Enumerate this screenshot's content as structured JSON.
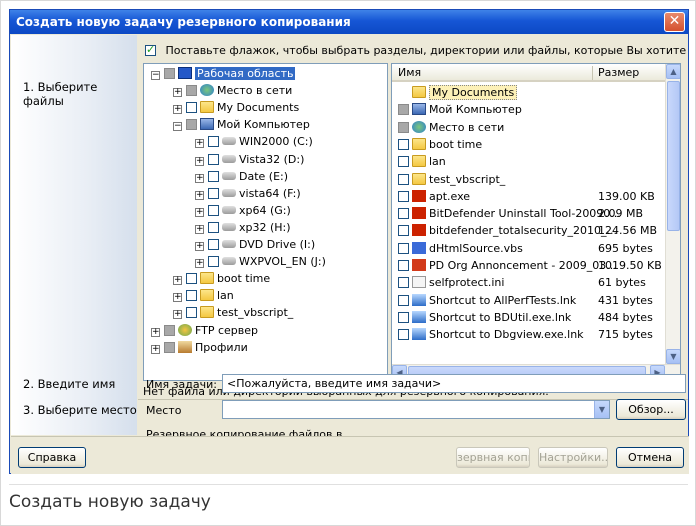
{
  "window": {
    "title": "Создать новую задачу резервного копирования",
    "close_label": "✕"
  },
  "steps": {
    "step1": "1. Выберите файлы",
    "step2": "2. Введите имя",
    "step3": "3. Выберите место"
  },
  "select_all_label": "Поставьте флажок, чтобы выбрать разделы, директории или файлы, которые Вы хотите",
  "tree": [
    {
      "label": "Рабочая область",
      "icon": "workspace-icon",
      "level": 0,
      "expander": "−",
      "state": "gray",
      "selected": true
    },
    {
      "label": "Место в сети",
      "icon": "network-icon",
      "level": 1,
      "expander": "+",
      "state": "gray"
    },
    {
      "label": "My Documents",
      "icon": "folder-icon",
      "level": 1,
      "expander": "+",
      "state": "empty"
    },
    {
      "label": "Мой Компьютер",
      "icon": "computer-icon",
      "level": 1,
      "expander": "−",
      "state": "gray"
    },
    {
      "label": "WIN2000 (C:)",
      "icon": "drive-icon",
      "level": 2,
      "expander": "+",
      "state": "empty"
    },
    {
      "label": "Vista32 (D:)",
      "icon": "drive-icon",
      "level": 2,
      "expander": "+",
      "state": "empty"
    },
    {
      "label": "Date (E:)",
      "icon": "drive-icon",
      "level": 2,
      "expander": "+",
      "state": "empty"
    },
    {
      "label": "vista64 (F:)",
      "icon": "drive-icon",
      "level": 2,
      "expander": "+",
      "state": "empty"
    },
    {
      "label": "xp64 (G:)",
      "icon": "drive-icon",
      "level": 2,
      "expander": "+",
      "state": "empty"
    },
    {
      "label": "xp32 (H:)",
      "icon": "drive-icon",
      "level": 2,
      "expander": "+",
      "state": "empty"
    },
    {
      "label": "DVD Drive (I:)",
      "icon": "dvd-icon",
      "level": 2,
      "expander": "+",
      "state": "empty"
    },
    {
      "label": "WXPVOL_EN (J:)",
      "icon": "dvd-icon",
      "level": 2,
      "expander": "+",
      "state": "empty"
    },
    {
      "label": "boot time",
      "icon": "folder-icon",
      "level": 1,
      "expander": "+",
      "state": "empty"
    },
    {
      "label": "lan",
      "icon": "folder-icon",
      "level": 1,
      "expander": "+",
      "state": "empty"
    },
    {
      "label": "test_vbscript_",
      "icon": "folder-icon",
      "level": 1,
      "expander": "+",
      "state": "empty"
    },
    {
      "label": "FTP сервер",
      "icon": "ftp-icon",
      "level": 0,
      "expander": "+",
      "state": "gray"
    },
    {
      "label": "Профили",
      "icon": "profile-icon",
      "level": 0,
      "expander": "+",
      "state": "gray"
    }
  ],
  "filelist": {
    "col_name": "Имя",
    "col_size": "Размер",
    "rows": [
      {
        "name": "My Documents",
        "size": "",
        "icon": "folder-icon",
        "state": "none"
      },
      {
        "name": "Мой Компьютер",
        "size": "",
        "icon": "computer-icon",
        "state": "gray"
      },
      {
        "name": "Место в сети",
        "size": "",
        "icon": "network-icon",
        "state": "gray"
      },
      {
        "name": "boot time",
        "size": "",
        "icon": "folder-icon",
        "state": "empty"
      },
      {
        "name": "lan",
        "size": "",
        "icon": "folder-icon",
        "state": "empty"
      },
      {
        "name": "test_vbscript_",
        "size": "",
        "icon": "folder-icon",
        "state": "empty"
      },
      {
        "name": "apt.exe",
        "size": "139.00 KB",
        "icon": "exe-icon",
        "state": "empty"
      },
      {
        "name": "BitDefender Uninstall Tool-20090...",
        "size": "2.09 MB",
        "icon": "exe-icon",
        "state": "empty"
      },
      {
        "name": "bitdefender_totalsecurity_2010_...",
        "size": "124.56 MB",
        "icon": "exe-icon",
        "state": "empty"
      },
      {
        "name": "dHtmlSource.vbs",
        "size": "695 bytes",
        "icon": "vbs-icon",
        "state": "empty"
      },
      {
        "name": "PD Org Annoncement - 2009_03...",
        "size": "1019.50 KB",
        "icon": "pdf-icon",
        "state": "empty"
      },
      {
        "name": "selfprotect.ini",
        "size": "61 bytes",
        "icon": "ini-icon",
        "state": "empty"
      },
      {
        "name": "Shortcut to AllPerfTests.lnk",
        "size": "431 bytes",
        "icon": "shortcut-icon",
        "state": "empty"
      },
      {
        "name": "Shortcut to BDUtil.exe.lnk",
        "size": "484 bytes",
        "icon": "shortcut-icon",
        "state": "empty"
      },
      {
        "name": "Shortcut to Dbgview.exe.lnk",
        "size": "715 bytes",
        "icon": "shortcut-icon",
        "state": "empty"
      }
    ]
  },
  "status_text": "Нет файла или директории выбранных для резервного копирования.",
  "task_name": {
    "label": "Имя задачи:",
    "value": "<Пожалуйста, введите имя задачи>"
  },
  "location": {
    "label": "Место",
    "value": "",
    "browse_label": "Обзор..."
  },
  "backup_info": "Резервное копирование файлов в .",
  "buttons": {
    "help": "Справка",
    "backup": "зервная копи",
    "settings": "Настройки...",
    "cancel": "Отмена"
  },
  "caption": "Создать новую задачу"
}
